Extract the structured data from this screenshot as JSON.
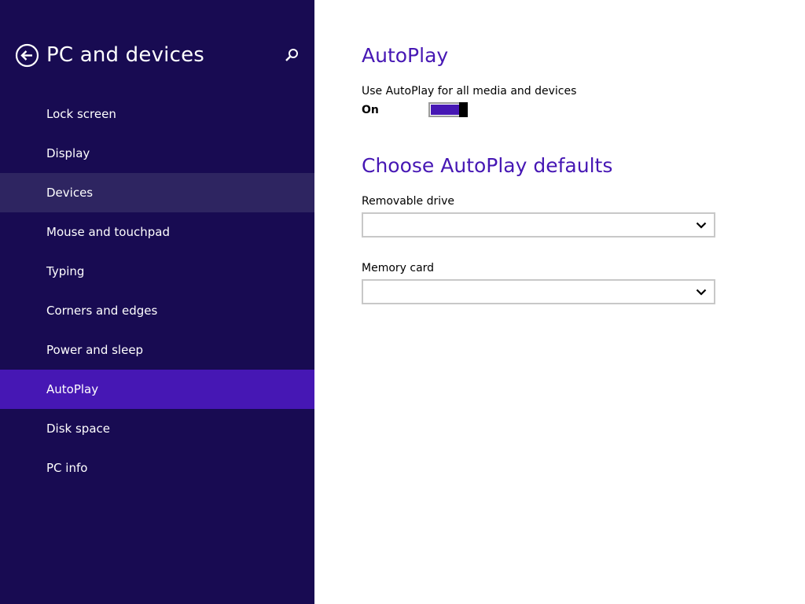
{
  "sidebar": {
    "title": "PC and devices",
    "back_icon": "back-arrow-icon",
    "search_icon": "search-icon",
    "items": [
      {
        "label": "Lock screen",
        "state": "normal"
      },
      {
        "label": "Display",
        "state": "normal"
      },
      {
        "label": "Devices",
        "state": "hover"
      },
      {
        "label": "Mouse and touchpad",
        "state": "normal"
      },
      {
        "label": "Typing",
        "state": "normal"
      },
      {
        "label": "Corners and edges",
        "state": "normal"
      },
      {
        "label": "Power and sleep",
        "state": "normal"
      },
      {
        "label": "AutoPlay",
        "state": "selected"
      },
      {
        "label": "Disk space",
        "state": "normal"
      },
      {
        "label": "PC info",
        "state": "normal"
      }
    ]
  },
  "main": {
    "title": "AutoPlay",
    "autoplay_setting": {
      "label": "Use AutoPlay for all media and devices",
      "state_label": "On",
      "enabled": true
    },
    "defaults_title": "Choose AutoPlay defaults",
    "removable_drive": {
      "label": "Removable drive",
      "value": ""
    },
    "memory_card": {
      "label": "Memory card",
      "value": ""
    }
  },
  "colors": {
    "sidebar_bg": "#180b52",
    "accent": "#4617b4",
    "hover_bg": "#2e2561",
    "text_light": "#ffffff",
    "text_dark": "#000000"
  }
}
